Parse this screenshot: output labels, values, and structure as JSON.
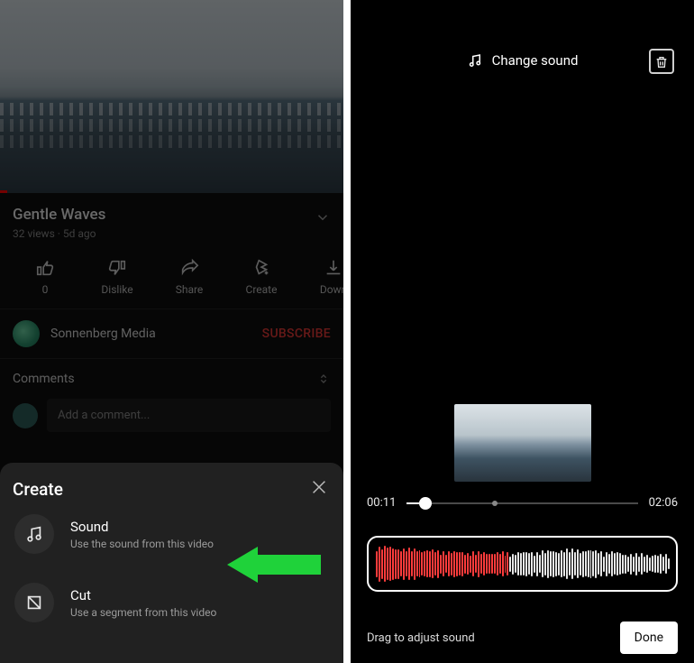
{
  "left": {
    "video": {
      "title": "Gentle Waves",
      "views": "32 views",
      "age": "5d ago"
    },
    "actions": {
      "like_label": "0",
      "dislike_label": "Dislike",
      "share_label": "Share",
      "create_label": "Create",
      "download_label": "Down"
    },
    "channel": {
      "name": "Sonnenberg Media",
      "subscribe_label": "SUBSCRIBE"
    },
    "comments": {
      "header": "Comments",
      "placeholder": "Add a comment..."
    },
    "sheet": {
      "title": "Create",
      "items": [
        {
          "icon": "music-note-icon",
          "title": "Sound",
          "desc": "Use the sound from this video"
        },
        {
          "icon": "cut-icon",
          "title": "Cut",
          "desc": "Use a segment from this video"
        }
      ]
    }
  },
  "right": {
    "change_sound_label": "Change sound",
    "time": {
      "current": "00:11",
      "total": "02:06",
      "progress_pct": 8
    },
    "drag_label": "Drag to adjust sound",
    "done_label": "Done",
    "waveform": {
      "played_bars": 50,
      "total_bars": 110,
      "played_color": "#ff3b3b",
      "unplayed_color": "#e6e6e6"
    }
  }
}
